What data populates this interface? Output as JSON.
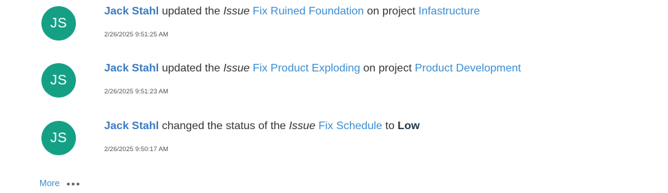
{
  "activities": [
    {
      "avatar_initials": "JS",
      "user": "Jack Stahl",
      "action": " updated the ",
      "entity_type": "Issue",
      "entity_name": "Fix Ruined Foundation",
      "connector": " on project ",
      "project": "Infastructure",
      "timestamp": "2/26/2025 9:51:25 AM"
    },
    {
      "avatar_initials": "JS",
      "user": "Jack Stahl",
      "action": " updated the ",
      "entity_type": "Issue",
      "entity_name": "Fix Product Exploding",
      "connector": " on project ",
      "project": "Product Development",
      "timestamp": "2/26/2025 9:51:23 AM"
    },
    {
      "avatar_initials": "JS",
      "user": "Jack Stahl",
      "action": " changed the status of the ",
      "entity_type": "Issue",
      "entity_name": "Fix Schedule",
      "connector": " to ",
      "status_value": "Low",
      "timestamp": "2/26/2025 9:50:17 AM"
    }
  ],
  "footer": {
    "more_label": "More",
    "more_icon": "ellipsis-icon"
  },
  "colors": {
    "avatar_bg": "#15a085",
    "link": "#3b8dd1",
    "user_link": "#3b7ac2"
  }
}
